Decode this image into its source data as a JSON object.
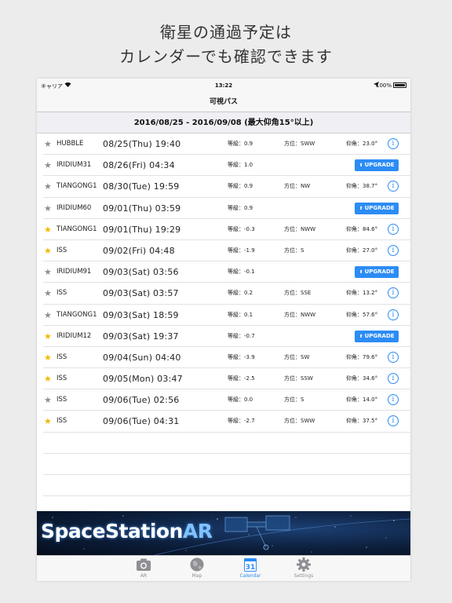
{
  "promo": {
    "line1": "衛星の通過予定は",
    "line2": "カレンダーでも確認できます"
  },
  "status": {
    "carrier": "キャリア",
    "time": "13:22",
    "battery": "100%"
  },
  "nav": {
    "title": "可視パス"
  },
  "range": {
    "text": "2016/08/25 - 2016/09/08 (最大仰角15°以上)"
  },
  "colors": {
    "accent": "#2c8cf4",
    "star_gold": "#f5b800",
    "star_gray": "#8e8e93"
  },
  "passes": [
    {
      "starred": false,
      "sat": "HUBBLE",
      "dt": "08/25(Thu) 19:40",
      "mag": "等級：0.9",
      "dir": "方位：SWW",
      "elev": "仰角：23.0°",
      "action": "info"
    },
    {
      "starred": false,
      "sat": "IRIDIUM31",
      "dt": "08/26(Fri) 04:34",
      "mag": "等級：1.0",
      "dir": "",
      "elev": "",
      "action": "upgrade"
    },
    {
      "starred": false,
      "sat": "TIANGONG1",
      "dt": "08/30(Tue) 19:59",
      "mag": "等級：0.9",
      "dir": "方位：NW",
      "elev": "仰角：38.7°",
      "action": "info"
    },
    {
      "starred": false,
      "sat": "IRIDIUM60",
      "dt": "09/01(Thu) 03:59",
      "mag": "等級：0.9",
      "dir": "",
      "elev": "",
      "action": "upgrade"
    },
    {
      "starred": true,
      "sat": "TIANGONG1",
      "dt": "09/01(Thu) 19:29",
      "mag": "等級：-0.3",
      "dir": "方位：NWW",
      "elev": "仰角：84.6°",
      "action": "info"
    },
    {
      "starred": true,
      "sat": "ISS",
      "dt": "09/02(Fri) 04:48",
      "mag": "等級：-1.9",
      "dir": "方位：S",
      "elev": "仰角：27.0°",
      "action": "info"
    },
    {
      "starred": false,
      "sat": "IRIDIUM91",
      "dt": "09/03(Sat) 03:56",
      "mag": "等級：-0.1",
      "dir": "",
      "elev": "",
      "action": "upgrade"
    },
    {
      "starred": false,
      "sat": "ISS",
      "dt": "09/03(Sat) 03:57",
      "mag": "等級：0.2",
      "dir": "方位：SSE",
      "elev": "仰角：13.2°",
      "action": "info"
    },
    {
      "starred": false,
      "sat": "TIANGONG1",
      "dt": "09/03(Sat) 18:59",
      "mag": "等級：0.1",
      "dir": "方位：NWW",
      "elev": "仰角：57.6°",
      "action": "info"
    },
    {
      "starred": true,
      "sat": "IRIDIUM12",
      "dt": "09/03(Sat) 19:37",
      "mag": "等級：-0.7",
      "dir": "",
      "elev": "",
      "action": "upgrade"
    },
    {
      "starred": true,
      "sat": "ISS",
      "dt": "09/04(Sun) 04:40",
      "mag": "等級：-3.9",
      "dir": "方位：SW",
      "elev": "仰角：79.6°",
      "action": "info"
    },
    {
      "starred": true,
      "sat": "ISS",
      "dt": "09/05(Mon) 03:47",
      "mag": "等級：-2.5",
      "dir": "方位：SSW",
      "elev": "仰角：34.6°",
      "action": "info"
    },
    {
      "starred": false,
      "sat": "ISS",
      "dt": "09/06(Tue) 02:56",
      "mag": "等級：0.0",
      "dir": "方位：S",
      "elev": "仰角：14.0°",
      "action": "info"
    },
    {
      "starred": true,
      "sat": "ISS",
      "dt": "09/06(Tue) 04:31",
      "mag": "等級：-2.7",
      "dir": "方位：SWW",
      "elev": "仰角：37.5°",
      "action": "info"
    }
  ],
  "upgrade_label": "UPGRADE",
  "info_label": "i",
  "banner": {
    "title_main": "SpaceStation",
    "title_ar": "AR"
  },
  "tabs": [
    {
      "label": "AR",
      "icon": "camera-icon",
      "active": false
    },
    {
      "label": "Map",
      "icon": "globe-icon",
      "active": false
    },
    {
      "label": "Calendar",
      "icon": "calendar-icon",
      "active": true,
      "badge": "31"
    },
    {
      "label": "Settings",
      "icon": "gear-icon",
      "active": false
    }
  ]
}
